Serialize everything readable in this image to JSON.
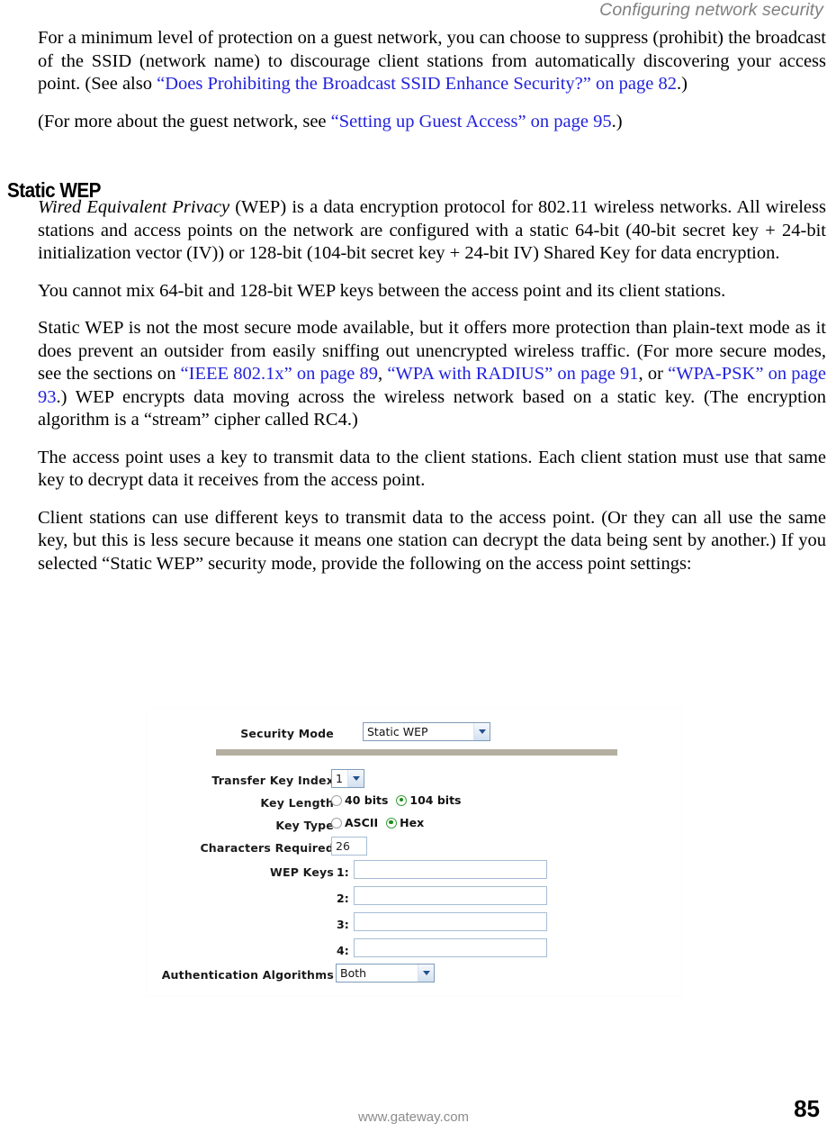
{
  "header": {
    "running_head": "Configuring network security"
  },
  "body": {
    "paragraph_1_part1": "For a minimum level of protection on a guest network, you can choose to suppress (prohibit) the broadcast of the SSID (network name) to discourage client stations from automatically discovering your access point. (See also ",
    "paragraph_1_xref": "“Does Prohibiting the Broadcast SSID Enhance Security?” on page 82",
    "paragraph_1_part2": ".)",
    "paragraph_2_part1": "(For more about the guest network, see ",
    "paragraph_2_xref": "“Setting up Guest Access” on page 95",
    "paragraph_2_part2": ".)",
    "section_heading": "Static WEP",
    "paragraph_3_italic": "Wired Equivalent Privacy",
    "paragraph_3_rest": " (WEP) is a data encryption protocol for 802.11 wireless networks. All wireless stations and access points on the network are configured with a static 64-bit (40-bit secret key + 24-bit initialization vector (IV)) or 128-bit (104-bit secret key + 24-bit IV) Shared Key for data encryption.",
    "paragraph_4": "You cannot mix 64-bit and 128-bit WEP keys between the access point and its client stations.",
    "paragraph_5_part1": "Static WEP is not the most secure mode available, but it offers more protection than plain-text mode as it does prevent an outsider from easily sniffing out unencrypted wireless traffic. (For more secure modes, see the sections on ",
    "paragraph_5_xref1": "“IEEE 802.1x” on page 89",
    "paragraph_5_sep1": ", ",
    "paragraph_5_xref2": "“WPA with RADIUS” on page 91",
    "paragraph_5_sep2": ", or ",
    "paragraph_5_xref3": "“WPA-PSK” on page 93",
    "paragraph_5_part2": ".) WEP encrypts data moving across the wireless network based on a static key. (The encryption algorithm is a “stream” cipher called RC4.)",
    "paragraph_6": "The access point uses a key to transmit data to the client stations. Each client station must use that same key to decrypt data it receives from the access point.",
    "paragraph_7": "Client stations can use different keys to transmit data to the access point. (Or they can all use the same key, but this is less secure because it means one station can decrypt the data being sent by another.) If you selected “Static WEP” security mode, provide the following on the access point settings:"
  },
  "screenshot": {
    "security_mode": {
      "label": "Security Mode",
      "value": "Static WEP"
    },
    "transfer_key_index": {
      "label": "Transfer Key Index",
      "value": "1"
    },
    "key_length": {
      "label": "Key Length",
      "options": [
        {
          "label": "40 bits",
          "selected": false
        },
        {
          "label": "104 bits",
          "selected": true
        }
      ]
    },
    "key_type": {
      "label": "Key Type",
      "options": [
        {
          "label": "ASCII",
          "selected": false
        },
        {
          "label": "Hex",
          "selected": true
        }
      ]
    },
    "characters_required": {
      "label": "Characters Required",
      "value": "26"
    },
    "wep_keys": {
      "label": "WEP Keys",
      "rows": [
        {
          "index": "1:",
          "value": ""
        },
        {
          "index": "2:",
          "value": ""
        },
        {
          "index": "3:",
          "value": ""
        },
        {
          "index": "4:",
          "value": ""
        }
      ]
    },
    "authentication_algorithms": {
      "label": "Authentication Algorithms",
      "value": "Both"
    }
  },
  "footer": {
    "url": "www.gateway.com",
    "page_number": "85"
  },
  "colors": {
    "xref_link": "#2222dd",
    "running_head": "#808080",
    "divider_bar": "#b3afa0",
    "radio_selected": "#1e8a1e",
    "input_border": "#a7bdd4",
    "select_border": "#7f9db9"
  }
}
